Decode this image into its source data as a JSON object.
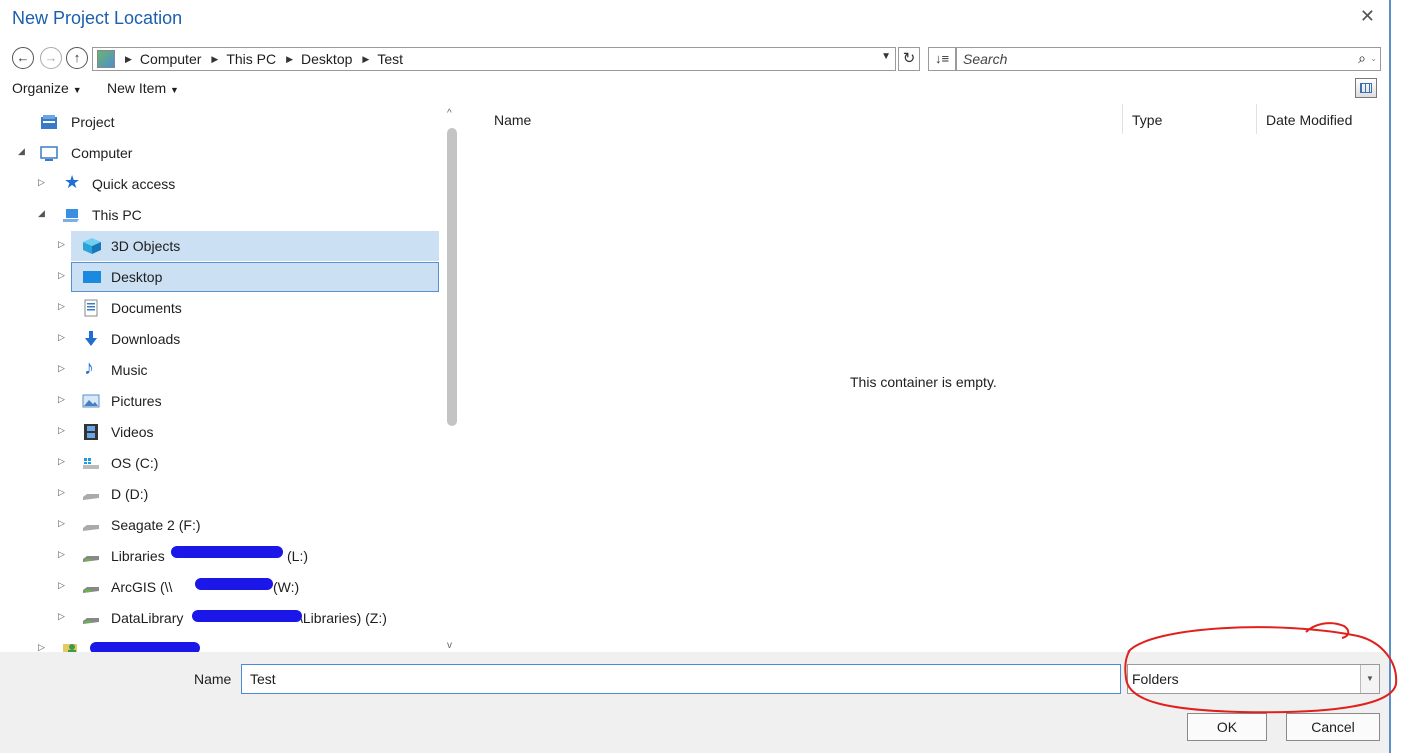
{
  "dialog": {
    "title": "New Project Location",
    "close_glyph": "✕"
  },
  "nav": {
    "back_glyph": "←",
    "forward_glyph": "→",
    "up_glyph": "↑",
    "breadcrumb": [
      "Computer",
      "This PC",
      "Desktop",
      "Test"
    ],
    "dropdown_glyph": "▼",
    "refresh_glyph": "↻",
    "sort_glyph": "↓≡",
    "search_placeholder": "Search",
    "search_glyph": "⌕",
    "search_dd_glyph": "⌄"
  },
  "toolbar": {
    "organize": "Organize",
    "new_item": "New Item",
    "caret": "▼"
  },
  "tree": {
    "items": [
      {
        "label": "Project"
      },
      {
        "label": "Computer"
      },
      {
        "label": "Quick access"
      },
      {
        "label": "This PC"
      },
      {
        "label": "3D Objects"
      },
      {
        "label": "Desktop"
      },
      {
        "label": "Documents"
      },
      {
        "label": "Downloads"
      },
      {
        "label": "Music"
      },
      {
        "label": "Pictures"
      },
      {
        "label": "Videos"
      },
      {
        "label": "OS (C:)"
      },
      {
        "label": "D (D:)"
      },
      {
        "label": "Seagate 2 (F:)"
      },
      {
        "label": "Libraries",
        "suffix": "(L:)"
      },
      {
        "label": "ArcGIS (\\\\",
        "suffix": "(W:)"
      },
      {
        "label": "DataLibrary",
        "suffix": "\\Libraries) (Z:)"
      }
    ]
  },
  "content": {
    "columns": {
      "name": "Name",
      "type": "Type",
      "date": "Date Modified"
    },
    "empty_message": "This container is empty."
  },
  "footer": {
    "name_label": "Name",
    "name_value": "Test",
    "type_value": "Folders",
    "type_dd_glyph": "▼",
    "ok": "OK",
    "cancel": "Cancel"
  },
  "colors": {
    "accent": "#1b5fae",
    "selection": "#cce0f4",
    "annotation": "#e0201c",
    "redaction": "#1a17e8"
  }
}
